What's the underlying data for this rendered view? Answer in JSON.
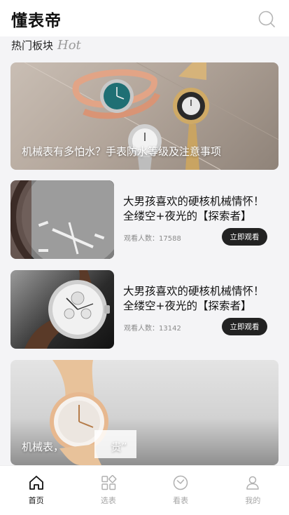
{
  "app": {
    "title": "懂表帝"
  },
  "section": {
    "title": "热门板块",
    "tag": "Hot"
  },
  "banners": [
    {
      "caption": "机械表有多怕水？手表防水等级及注意事项"
    },
    {
      "caption": "机械表，　　　　　贵”"
    }
  ],
  "cards": [
    {
      "title": "大男孩喜欢的硬核机械情怀！全缕空+夜光的【探索者】",
      "viewers_label": "观看人数：",
      "viewers": "17588",
      "button": "立即观看"
    },
    {
      "title": "大男孩喜欢的硬核机械情怀！全缕空+夜光的【探索者】",
      "viewers_label": "观看人数：",
      "viewers": "13142",
      "button": "立即观看"
    }
  ],
  "tabs": [
    {
      "label": "首页",
      "icon": "home-icon",
      "active": true
    },
    {
      "label": "选表",
      "icon": "grid-icon",
      "active": false
    },
    {
      "label": "看表",
      "icon": "watch-icon",
      "active": false
    },
    {
      "label": "我的",
      "icon": "user-icon",
      "active": false
    }
  ],
  "colors": {
    "accent": "#222222",
    "inactive": "#a6a6a6",
    "background": "#f4f4f6"
  }
}
